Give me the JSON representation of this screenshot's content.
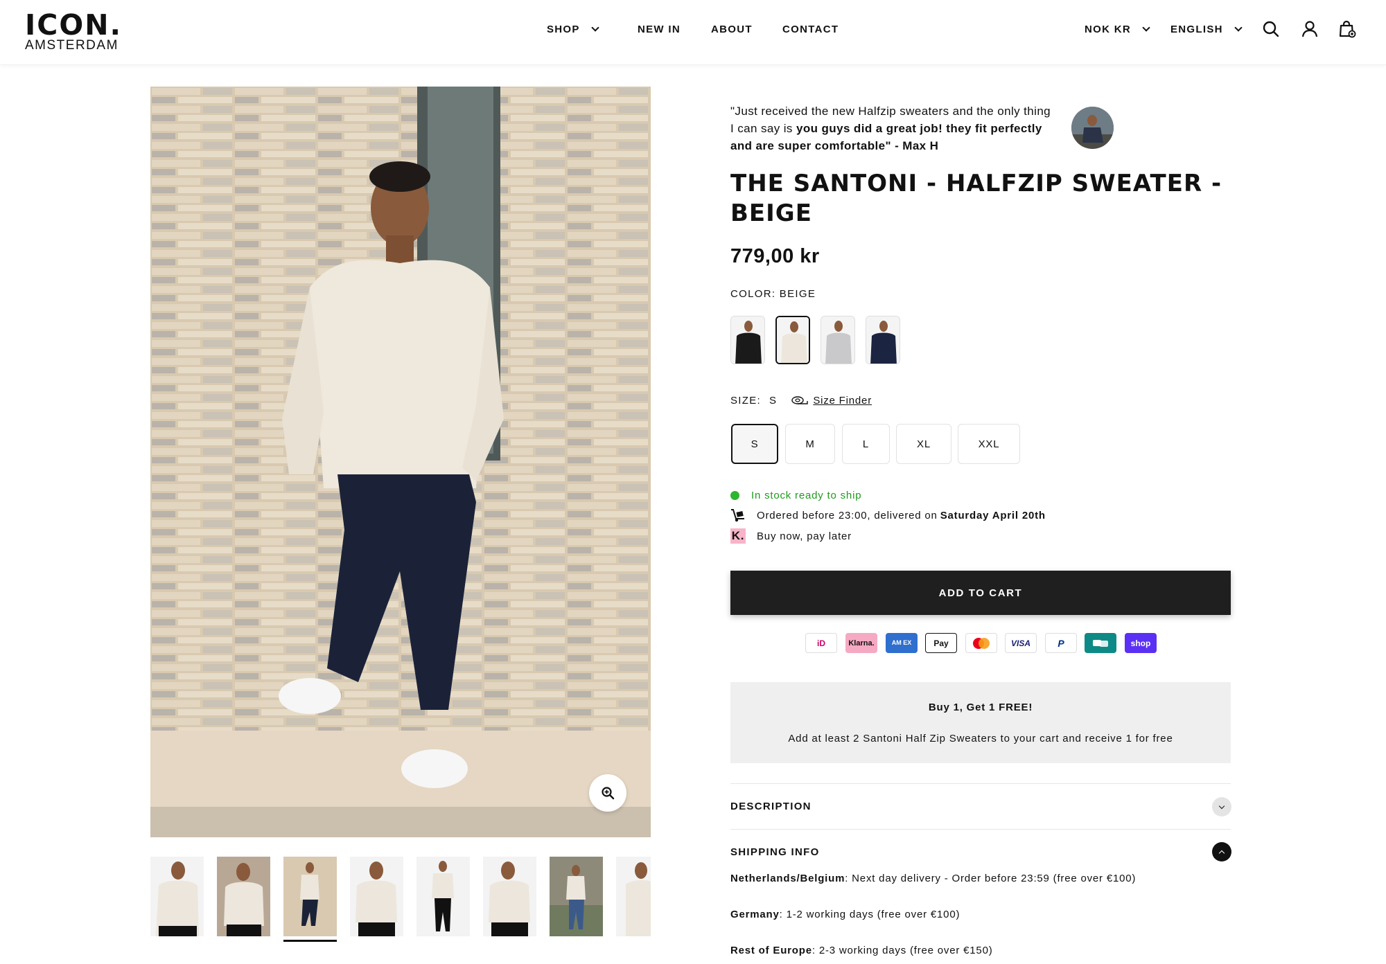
{
  "header": {
    "logo_main": "ICON.",
    "logo_sub": "AMSTERDAM",
    "nav": {
      "shop": "SHOP",
      "new_in": "NEW IN",
      "about": "ABOUT",
      "contact": "CONTACT"
    },
    "currency": "NOK KR",
    "language": "ENGLISH",
    "icons": [
      "search-icon",
      "account-icon",
      "cart-icon"
    ]
  },
  "review": {
    "part1": "\"Just received the new Halfzip sweaters and the only thing I can say is ",
    "bold": "you guys did a great job! they fit perfectly and are super comfortable\" - Max H"
  },
  "product": {
    "title": "THE SANTONI - HALFZIP SWEATER - BEIGE",
    "price": "779,00 kr",
    "color_label": "COLOR:",
    "color_value": "BEIGE",
    "swatches": [
      {
        "name": "black",
        "color": "#1a1a1a",
        "selected": false
      },
      {
        "name": "beige",
        "color": "#ece6dc",
        "selected": true
      },
      {
        "name": "grey",
        "color": "#c9c9cc",
        "selected": false
      },
      {
        "name": "navy",
        "color": "#1b2440",
        "selected": false
      }
    ],
    "size_label": "SIZE:",
    "size_value": "S",
    "size_finder": "Size Finder",
    "sizes": [
      {
        "label": "S",
        "selected": true
      },
      {
        "label": "M",
        "selected": false
      },
      {
        "label": "L",
        "selected": false
      },
      {
        "label": "XL",
        "selected": false
      },
      {
        "label": "XXL",
        "selected": false
      }
    ],
    "stock": "In stock ready to ship",
    "delivery_prefix": "Ordered before 23:00, delivered on ",
    "delivery_date": "Saturday April 20th",
    "klarna": "Buy now, pay later",
    "add_to_cart": "ADD TO CART"
  },
  "payments": {
    "ideal": "iD",
    "klarna": "Klarna.",
    "amex": "AM EX",
    "applepay": "Pay",
    "visa": "VISA",
    "paypal": "P",
    "bancontact": "",
    "shop": "shop"
  },
  "promo": {
    "title": "Buy 1, Get 1 FREE!",
    "text": "Add at least 2 Santoni Half Zip Sweaters to your cart and receive 1 for free"
  },
  "accordion": {
    "description": "DESCRIPTION",
    "shipping": "SHIPPING INFO",
    "shipping_lines": [
      {
        "region": "Netherlands/Belgium",
        "text": ": Next day delivery - Order before 23:59 (free over €100)"
      },
      {
        "region": "Germany",
        "text": ": 1-2 working days (free over €100)"
      },
      {
        "region": "Rest of Europe",
        "text": ": 2-3 working days (free over €150)"
      }
    ]
  },
  "colors": {
    "accent": "#1f1f1f",
    "stock_green": "#2fb52f",
    "promo_bg": "#efefef"
  }
}
